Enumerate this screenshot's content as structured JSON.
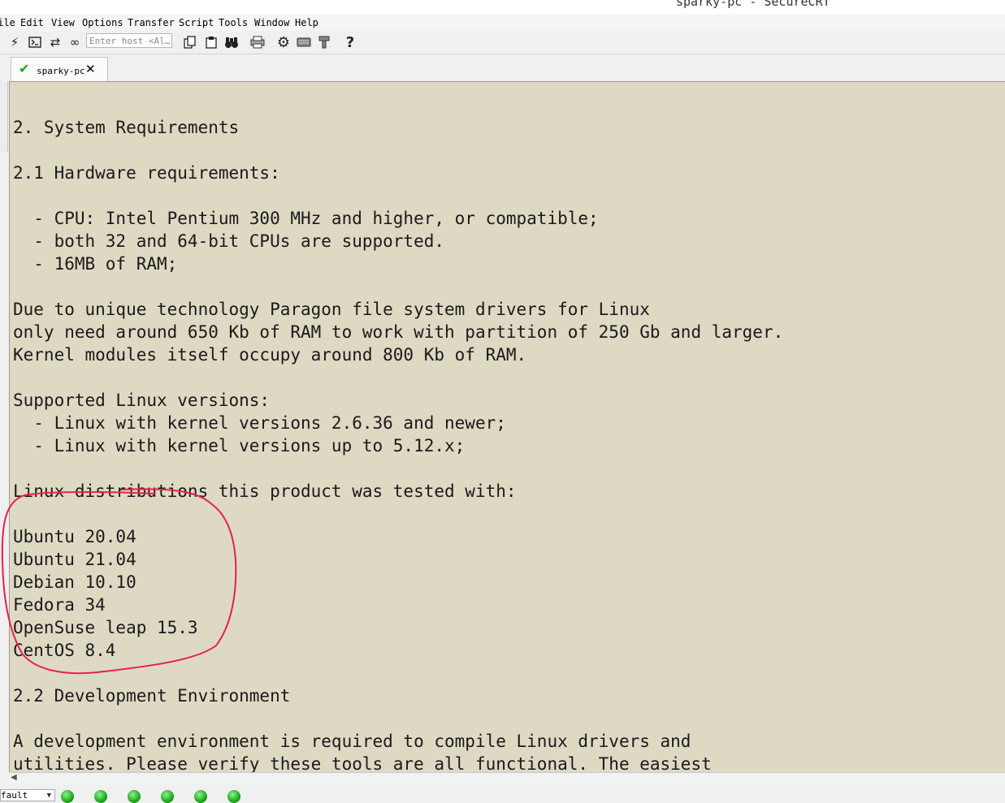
{
  "window": {
    "title": "sparky-pc - SecureCRT"
  },
  "menu": [
    "File",
    "Edit",
    "View",
    "Options",
    "Transfer",
    "Script",
    "Tools",
    "Window",
    "Help"
  ],
  "toolbar": {
    "host_placeholder": "Enter host <Al…",
    "icons": [
      "connect-icon",
      "terminal-icon",
      "reconnect-icon",
      "link-icon",
      "copy-icon",
      "paste-icon",
      "find-icon",
      "print-icon",
      "settings-icon",
      "keyboard-icon",
      "keymap-icon",
      "help-icon"
    ]
  },
  "tab": {
    "label": "sparky-pc",
    "status_color": "#1ea31e"
  },
  "terminal": {
    "background": "#ded9c3",
    "lines": [
      "",
      "2. System Requirements",
      "",
      "2.1 Hardware requirements:",
      "",
      "  - CPU: Intel Pentium 300 MHz and higher, or compatible;",
      "  - both 32 and 64-bit CPUs are supported.",
      "  - 16MB of RAM;",
      "",
      "Due to unique technology Paragon file system drivers for Linux",
      "only need around 650 Kb of RAM to work with partition of 250 Gb and larger.",
      "Kernel modules itself occupy around 800 Kb of RAM.",
      "",
      "Supported Linux versions:",
      "  - Linux with kernel versions 2.6.36 and newer;",
      "  - Linux with kernel versions up to 5.12.x;",
      "",
      "Linux distributions this product was tested with:",
      "",
      "Ubuntu 20.04",
      "Ubuntu 21.04",
      "Debian 10.10",
      "Fedora 34",
      "OpenSuse leap 15.3",
      "CentOS 8.4",
      "",
      "2.2 Development Environment",
      "",
      "A development environment is required to compile Linux drivers and",
      "utilities. Please verify these tools are all functional. The easiest"
    ]
  },
  "status": {
    "session_label": "fault",
    "leds": 6,
    "led_color": "#1aa81a"
  },
  "annotation": {
    "color": "#e8204a"
  }
}
